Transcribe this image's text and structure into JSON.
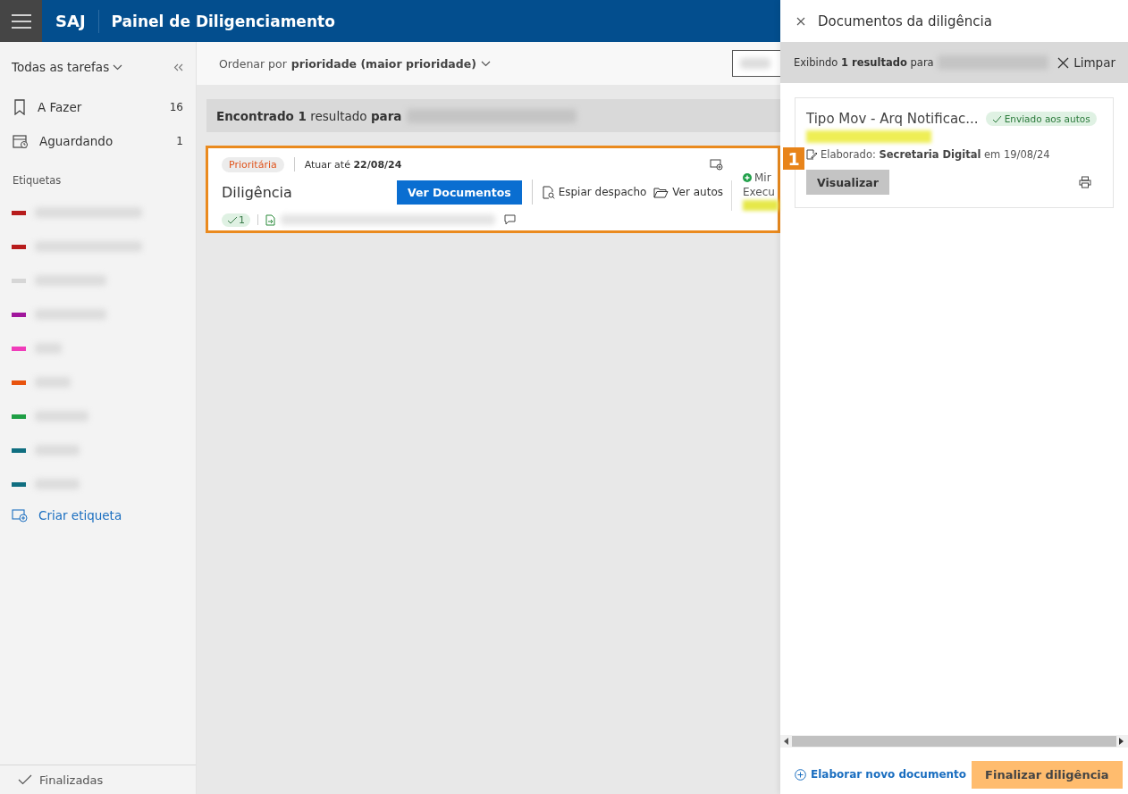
{
  "header": {
    "app_name": "SAJ",
    "title": "Painel de Diligenciamento"
  },
  "sidebar": {
    "filter": "Todas as tarefas",
    "items": [
      {
        "label": "A Fazer",
        "count": "16",
        "kind": "todo",
        "selected": false
      },
      {
        "label": "Aguardando",
        "count": "1",
        "kind": "waiting",
        "selected": false
      }
    ],
    "labels_heading": "Etiquetas",
    "labels": [
      {
        "color": "#b71c1c"
      },
      {
        "color": "#b71c1c"
      },
      {
        "color": "#d6d6d6"
      },
      {
        "color": "#a0169c"
      },
      {
        "color": "#f03cba"
      },
      {
        "color": "#e8530e"
      },
      {
        "color": "#1e9e44"
      },
      {
        "color": "#0f6e80"
      },
      {
        "color": "#0f6e80"
      }
    ],
    "create_label": "Criar etiqueta",
    "footer": "Finalizadas"
  },
  "sort": {
    "prefix": "Ordenar por",
    "value": "prioridade (maior prioridade)"
  },
  "results": {
    "text": "**Encontrado 1** resultado **para**"
  },
  "task_card": {
    "tag": "Prioritária",
    "deadline": "Atuar até **22/08/24**",
    "title": "Diligência",
    "primary_button": "Ver Documentos",
    "actions": [
      "Espiar despacho",
      "Ver autos"
    ],
    "check_count": "1",
    "side_status": "Mir",
    "side_label": "Execu"
  },
  "annotation": {
    "number": "1"
  },
  "panel": {
    "title": "Documentos da diligência",
    "filter_text": "Exibindo **1 resultado** para",
    "clear": "Limpar",
    "documents": [
      {
        "title": "Tipo Mov - Arq Notificac...",
        "status": "Enviado aos autos",
        "meta": "Elaborado: **Secretaria Digital** em 19/08/24",
        "button": "Visualizar"
      }
    ],
    "new_document": "Elaborar novo documento",
    "finish": "Finalizar diligência"
  }
}
